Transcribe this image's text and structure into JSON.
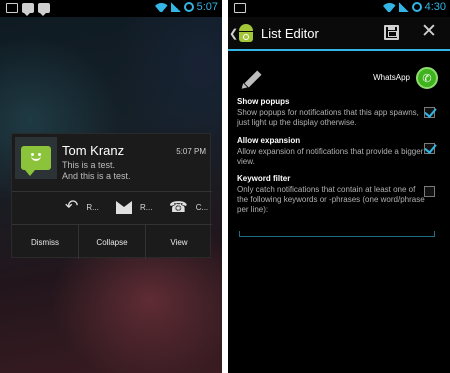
{
  "left_phone": {
    "status": {
      "time": "5:07"
    },
    "notification": {
      "sender": "Tom Kranz",
      "time": "5:07 PM",
      "lines": [
        "This is a test.",
        "And this is a test."
      ],
      "actions": [
        {
          "icon": "reply-icon",
          "label": "R..."
        },
        {
          "icon": "mark-read-icon",
          "label": "R..."
        },
        {
          "icon": "call-icon",
          "label": "C..."
        }
      ],
      "buttons": [
        "Dismiss",
        "Collapse",
        "View"
      ]
    }
  },
  "right_phone": {
    "status": {
      "time": "4:30"
    },
    "actionbar": {
      "title": "List Editor"
    },
    "app": {
      "name": "WhatsApp"
    },
    "prefs": [
      {
        "title": "Show popups",
        "summary": "Show popups for notifications that this app spawns, just light up the display otherwise.",
        "checked": true
      },
      {
        "title": "Allow expansion",
        "summary": "Allow expansion of notifications that provide a bigger view.",
        "checked": true
      },
      {
        "title": "Keyword filter",
        "summary": "Only catch notifications that contain at least one of the following keywords or -phrases (one word/phrase per line):",
        "checked": false
      }
    ]
  },
  "colors": {
    "accent": "#33b5e5",
    "sms_green": "#8bc33a",
    "whatsapp_green": "#3fb31e"
  }
}
